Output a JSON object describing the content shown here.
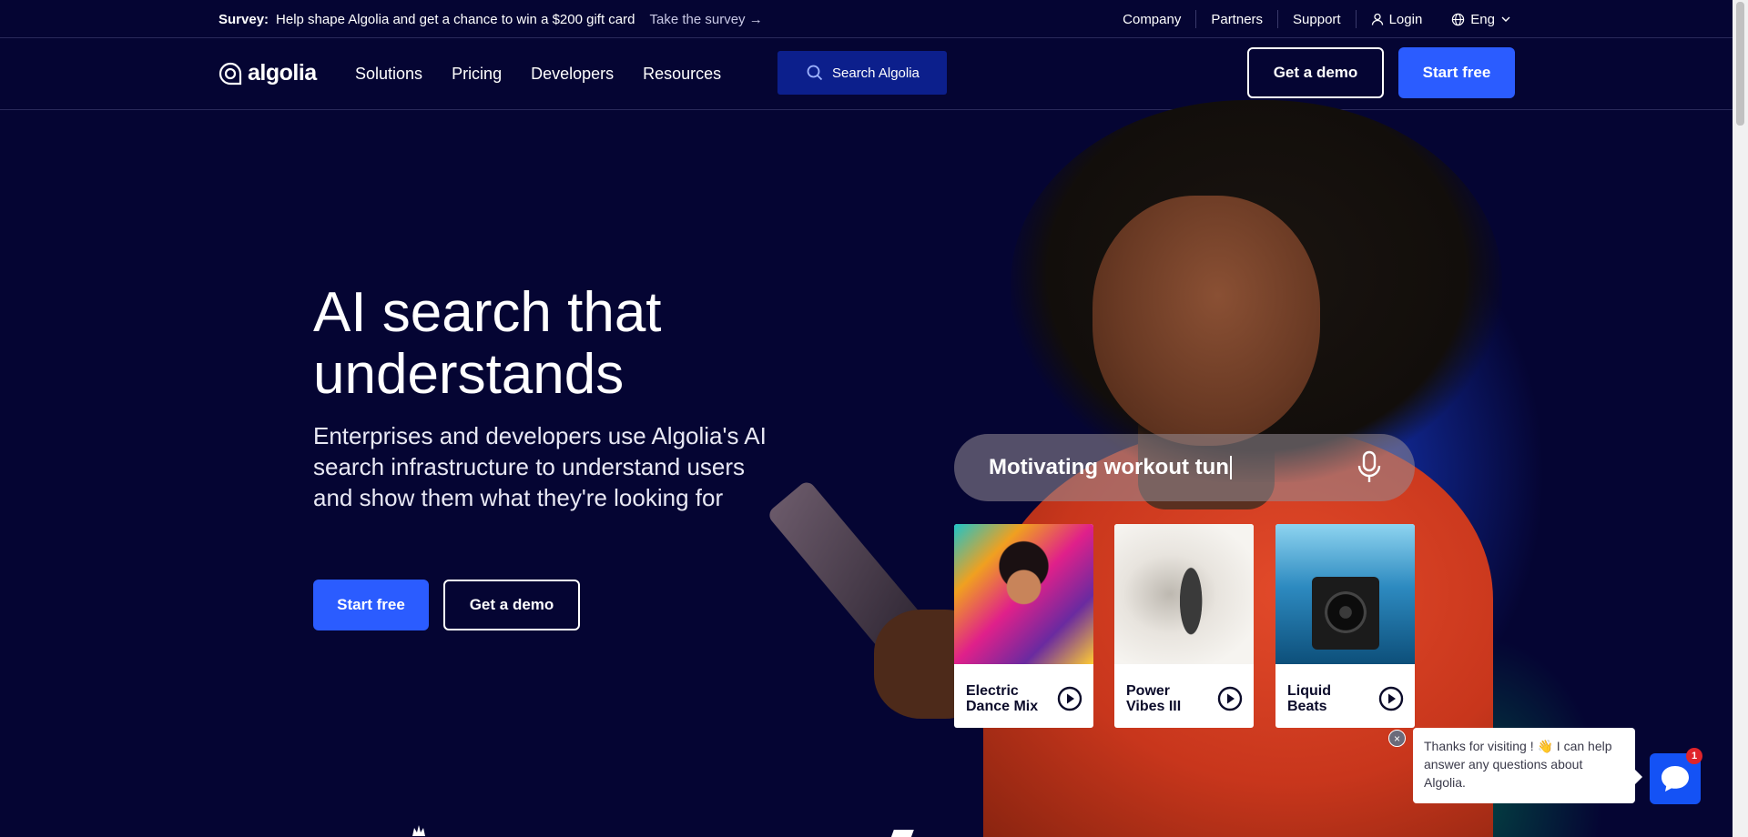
{
  "survey": {
    "prefix": "Survey:",
    "message": "Help shape Algolia and get a chance to win a $200 gift card",
    "link": "Take the survey →"
  },
  "utility_nav": {
    "company": "Company",
    "partners": "Partners",
    "support": "Support",
    "login": "Login",
    "language": "Eng"
  },
  "nav": {
    "logo": "algolia",
    "links": [
      "Solutions",
      "Pricing",
      "Developers",
      "Resources"
    ],
    "search_label": "Search Algolia",
    "demo_button": "Get a demo",
    "start_button": "Start free"
  },
  "hero": {
    "headline": "AI search that understands",
    "subtext": "Enterprises and developers use Algolia's AI search infrastructure to understand users and show them what they're looking for",
    "start_button": "Start free",
    "demo_button": "Get a demo"
  },
  "demo": {
    "query": "Motivating workout tun",
    "cards": [
      {
        "title": "Electric Dance Mix"
      },
      {
        "title": "Power Vibes III"
      },
      {
        "title": "Liquid Beats"
      }
    ]
  },
  "chat": {
    "message": "Thanks for visiting ! 👋 I can help answer any questions about Algolia.",
    "badge": "1",
    "close": "×"
  },
  "colors": {
    "background": "#050533",
    "primary": "#2b5cff",
    "search_bg": "#0c1f8c"
  }
}
